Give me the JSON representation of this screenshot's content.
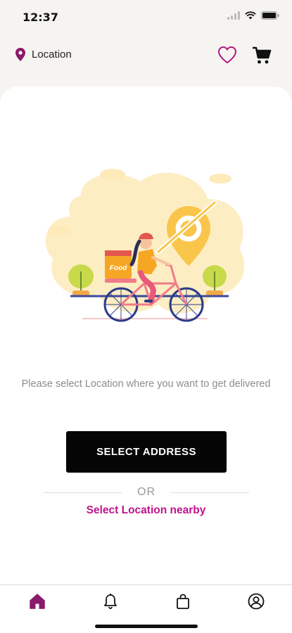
{
  "status_bar": {
    "time": "12:37"
  },
  "header": {
    "location_label": "Location"
  },
  "illustration": {
    "bag_label": "Food"
  },
  "main": {
    "message": "Please select Location where you want to get delivered",
    "select_button": "SELECT ADDRESS",
    "or_label": "OR",
    "nearby_link": "Select Location nearby"
  },
  "colors": {
    "accent": "#c2128a",
    "nav_active": "#8a1a6c",
    "button_bg": "#050505",
    "illustration_yellow": "#fde9b0",
    "pin_yellow": "#f9c54b"
  },
  "icons": {
    "location": "location-pin-icon",
    "favorite": "heart-icon",
    "cart": "cart-icon",
    "nav": [
      "home-icon",
      "bell-icon",
      "bag-icon",
      "user-icon"
    ]
  }
}
